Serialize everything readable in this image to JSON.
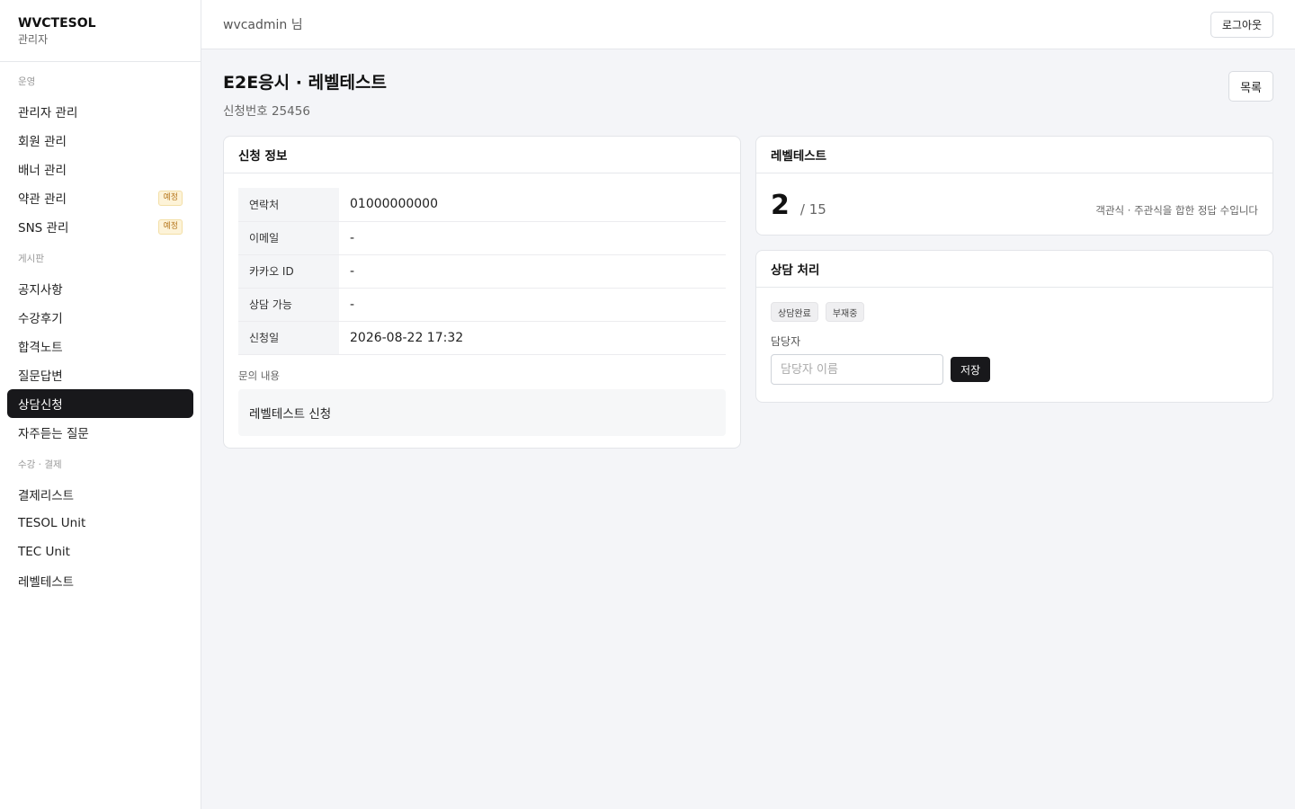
{
  "brand": {
    "name": "WVCTESOL",
    "sub": "관리자"
  },
  "topbar": {
    "user": "wvcadmin 님",
    "logout": "로그아웃"
  },
  "sidebar": {
    "groups": [
      {
        "label": "운영",
        "items": [
          {
            "label": "관리자 관리"
          },
          {
            "label": "회원 관리"
          },
          {
            "label": "배너 관리"
          },
          {
            "label": "약관 관리",
            "badge": "예정"
          },
          {
            "label": "SNS 관리",
            "badge": "예정"
          }
        ]
      },
      {
        "label": "게시판",
        "items": [
          {
            "label": "공지사항"
          },
          {
            "label": "수강후기"
          },
          {
            "label": "합격노트"
          },
          {
            "label": "질문답변"
          },
          {
            "label": "상담신청",
            "active": true
          },
          {
            "label": "자주듣는 질문"
          }
        ]
      },
      {
        "label": "수강 · 결제",
        "items": [
          {
            "label": "결제리스트"
          },
          {
            "label": "TESOL Unit"
          },
          {
            "label": "TEC Unit"
          },
          {
            "label": "레벨테스트"
          }
        ]
      }
    ]
  },
  "page": {
    "title": "E2E응시 · 레벨테스트",
    "subtitle": "신청번호 25456",
    "list_button": "목록"
  },
  "application": {
    "title": "신청 정보",
    "rows": [
      {
        "key": "연락처",
        "value": "01000000000"
      },
      {
        "key": "이메일",
        "value": "-"
      },
      {
        "key": "카카오 ID",
        "value": "-"
      },
      {
        "key": "상담 가능",
        "value": "-"
      },
      {
        "key": "신청일",
        "value": "2026-08-22 17:32"
      }
    ],
    "inquiry_label": "문의 내용",
    "inquiry_text": "레벨테스트 신청"
  },
  "leveltest": {
    "title": "레벨테스트",
    "score": "2",
    "total": "/ 15",
    "note": "객관식 · 주관식을 합한 정답 수입니다"
  },
  "consult": {
    "title": "상담 처리",
    "chips": [
      "상담완료",
      "부재중"
    ],
    "manager_label": "담당자",
    "manager_placeholder": "담당자 이름",
    "manager_value": "",
    "save": "저장"
  }
}
